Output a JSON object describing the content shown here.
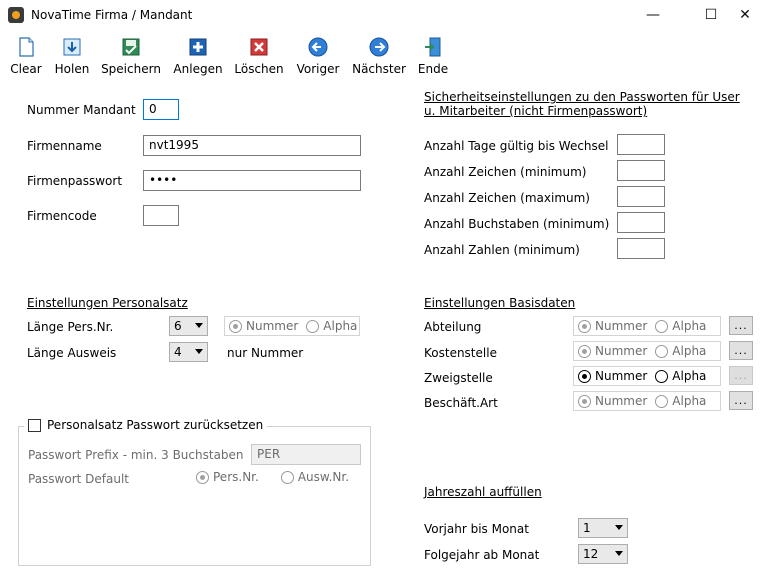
{
  "window": {
    "title": "NovaTime Firma / Mandant"
  },
  "toolbar": [
    {
      "id": "clear",
      "label": "Clear",
      "icon": "new-document-icon"
    },
    {
      "id": "holen",
      "label": "Holen",
      "icon": "fetch-icon"
    },
    {
      "id": "speichern",
      "label": "Speichern",
      "icon": "save-icon"
    },
    {
      "id": "anlegen",
      "label": "Anlegen",
      "icon": "add-icon"
    },
    {
      "id": "loeschen",
      "label": "Löschen",
      "icon": "delete-icon"
    },
    {
      "id": "voriger",
      "label": "Voriger",
      "icon": "arrow-left-icon"
    },
    {
      "id": "naechster",
      "label": "Nächster",
      "icon": "arrow-right-icon"
    },
    {
      "id": "ende",
      "label": "Ende",
      "icon": "exit-door-icon"
    }
  ],
  "mandant": {
    "nummer_label": "Nummer Mandant",
    "nummer_value": "0",
    "firmenname_label": "Firmenname",
    "firmenname_value": "nvt1995",
    "passwort_label": "Firmenpasswort",
    "passwort_value": "••••",
    "code_label": "Firmencode",
    "code_value": ""
  },
  "security": {
    "heading": "Sicherheitseinstellungen zu den Passworten für User u. Mitarbeiter (nicht Firmenpasswort)",
    "rows": [
      {
        "label": "Anzahl Tage gültig bis Wechsel",
        "value": ""
      },
      {
        "label": "Anzahl Zeichen (minimum)",
        "value": ""
      },
      {
        "label": "Anzahl Zeichen (maximum)",
        "value": ""
      },
      {
        "label": "Anzahl Buchstaben (minimum)",
        "value": ""
      },
      {
        "label": "Anzahl Zahlen (minimum)",
        "value": ""
      }
    ]
  },
  "personalsatz": {
    "heading": "Einstellungen Personalsatz",
    "laenge_persnr_label": "Länge Pers.Nr.",
    "laenge_persnr_value": "6",
    "laenge_ausweis_label": "Länge Ausweis",
    "laenge_ausweis_value": "4",
    "radio_nummer": "Nummer",
    "radio_alpha": "Alpha",
    "nur_nummer": "nur Nummer"
  },
  "basisdaten": {
    "heading": "Einstellungen Basisdaten",
    "radio_nummer": "Nummer",
    "radio_alpha": "Alpha",
    "dots": "...",
    "rows": [
      {
        "label": "Abteilung",
        "enabled": false,
        "selected": "Nummer"
      },
      {
        "label": "Kostenstelle",
        "enabled": false,
        "selected": "Nummer"
      },
      {
        "label": "Zweigstelle",
        "enabled": true,
        "selected": "Nummer"
      },
      {
        "label": "Beschäft.Art",
        "enabled": false,
        "selected": "Nummer"
      }
    ]
  },
  "reset": {
    "checkbox_label": "Personalsatz Passwort zurücksetzen",
    "prefix_label": "Passwort Prefix - min. 3 Buchstaben",
    "prefix_value": "PER",
    "default_label": "Passwort Default",
    "radio_persnr": "Pers.Nr.",
    "radio_auswnr": "Ausw.Nr."
  },
  "jahreszahl": {
    "heading": "Jahreszahl auffüllen",
    "vorjahr_label": "Vorjahr bis Monat",
    "vorjahr_value": "1",
    "folgejahr_label": "Folgejahr ab Monat",
    "folgejahr_value": "12"
  },
  "colors": {
    "accent": "#0078d7",
    "disabled_text": "#6d6d6d"
  }
}
